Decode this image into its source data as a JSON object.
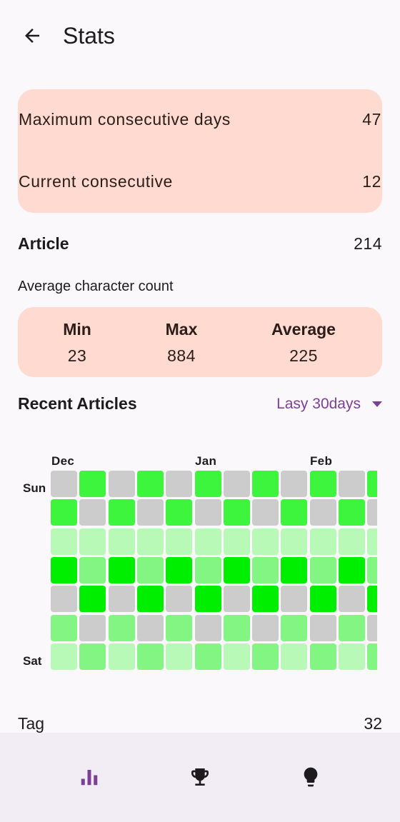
{
  "app_bar": {
    "title": "Stats"
  },
  "streak": {
    "max_label": "Maximum consecutive days",
    "max_value": "47",
    "current_label": "Current consecutive",
    "current_value": "12"
  },
  "article": {
    "label": "Article",
    "count": "214",
    "avg_char_label": "Average character count",
    "min_label": "Min",
    "min_value": "23",
    "max_label": "Max",
    "max_value": "884",
    "avg_label": "Average",
    "avg_value": "225"
  },
  "recent": {
    "title": "Recent Articles",
    "range_selected": "Lasy 30days"
  },
  "heatmap": {
    "months": [
      "Dec",
      "Jan",
      "Feb"
    ],
    "day_labels": [
      "Sun",
      "Sat"
    ],
    "colors": [
      "#cccccc",
      "#b8f9b8",
      "#82f582",
      "#3ef53e",
      "#00ee00"
    ],
    "levels": [
      [
        0,
        3,
        0,
        3,
        0,
        3,
        0,
        3,
        0,
        3,
        0,
        3
      ],
      [
        3,
        0,
        3,
        0,
        3,
        0,
        3,
        0,
        3,
        0,
        3,
        0
      ],
      [
        1,
        1,
        1,
        1,
        1,
        1,
        1,
        1,
        1,
        1,
        1,
        1
      ],
      [
        4,
        2,
        4,
        2,
        4,
        2,
        4,
        2,
        4,
        2,
        4,
        2
      ],
      [
        0,
        4,
        0,
        4,
        0,
        4,
        0,
        4,
        0,
        4,
        0,
        4
      ],
      [
        2,
        0,
        2,
        0,
        2,
        0,
        2,
        0,
        2,
        0,
        2,
        0
      ],
      [
        1,
        2,
        1,
        2,
        1,
        2,
        1,
        2,
        1,
        2,
        1,
        2
      ]
    ]
  },
  "tag": {
    "label": "Tag",
    "count": "32"
  },
  "bottom_nav": {
    "items": [
      {
        "icon": "bar-chart-icon",
        "active": true
      },
      {
        "icon": "trophy-icon",
        "active": false
      },
      {
        "icon": "lightbulb-icon",
        "active": false
      }
    ],
    "active_color": "#7c3f96",
    "inactive_color": "#1d1b1e"
  }
}
